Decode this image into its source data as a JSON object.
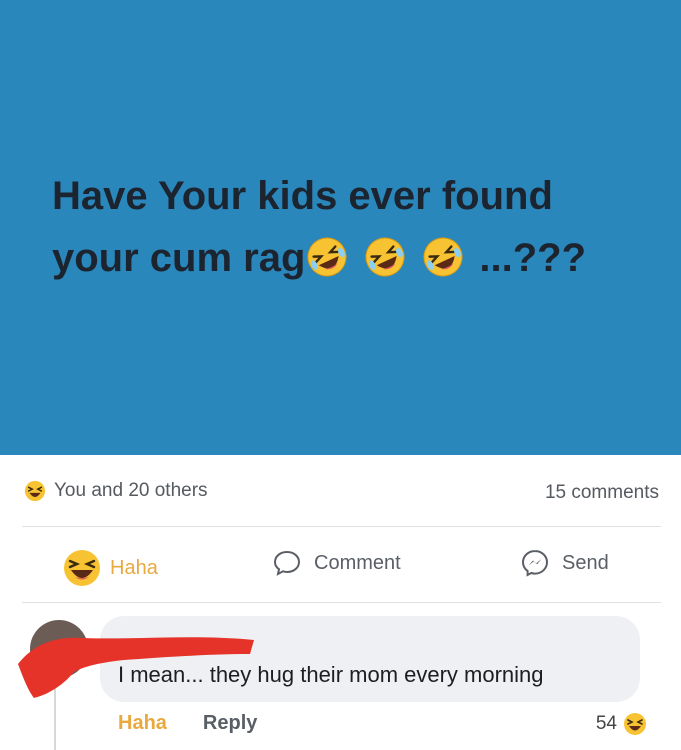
{
  "post": {
    "banner_line1": "Have Your kids ever found",
    "banner_line2_start": "your cum rag",
    "banner_line2_end": "...???",
    "banner_bg": "#2a87bb",
    "banner_emoji": "rolling-laughing-face-icon"
  },
  "reactions": {
    "summary": "You and 20 others",
    "comments_count": "15 comments",
    "icon": "haha-emoji-icon"
  },
  "actions": {
    "haha_label": "Haha",
    "comment_label": "Comment",
    "send_label": "Send"
  },
  "comment": {
    "text": "I mean... they hug their mom every morning",
    "haha_label": "Haha",
    "reply_label": "Reply",
    "reaction_count": "54"
  },
  "colors": {
    "haha": "#e8a93f",
    "redaction": "#e5332a"
  }
}
